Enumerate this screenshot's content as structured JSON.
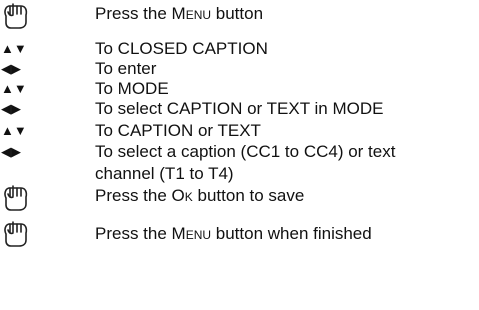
{
  "steps": [
    {
      "icon": "hand-press-icon",
      "parts": [
        "Press the ",
        "Menu",
        " button"
      ]
    },
    {
      "icon": "up-down-arrows-icon",
      "text": "To CLOSED CAPTION"
    },
    {
      "icon": "left-right-arrows-icon",
      "text": "To enter"
    },
    {
      "icon": "up-down-arrows-icon",
      "text": "To MODE"
    },
    {
      "icon": "left-right-arrows-icon",
      "text": "To select CAPTION or TEXT in MODE"
    },
    {
      "icon": "up-down-arrows-icon",
      "text": "To CAPTION or TEXT"
    },
    {
      "icon": "left-right-arrows-icon",
      "text_line1": "To select a caption (CC1 to CC4) or text",
      "text_line2": "channel (T1 to T4)"
    },
    {
      "icon": "hand-press-icon",
      "parts": [
        "Press the ",
        "Ok",
        " button to save"
      ]
    },
    {
      "icon": "hand-press-icon",
      "parts": [
        "Press the ",
        "Menu",
        " button when finished"
      ]
    }
  ],
  "glyphs": {
    "up_down": "▲▼",
    "left_right": "◀▶"
  }
}
